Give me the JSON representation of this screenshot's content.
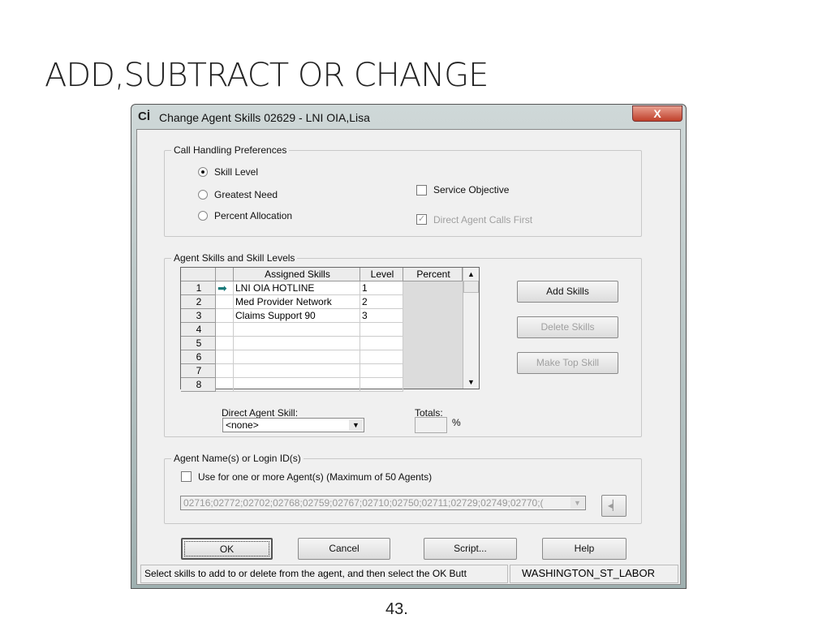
{
  "slide": {
    "title": "ADD,SUBTRACT OR CHANGE",
    "page_number": "43."
  },
  "dialog": {
    "title": "Change Agent Skills 02629 - LNI OIA,Lisa",
    "close_label": "X",
    "call_handling": {
      "label": "Call Handling Preferences",
      "options": [
        {
          "label": "Skill Level",
          "selected": true
        },
        {
          "label": "Greatest Need",
          "selected": false
        },
        {
          "label": "Percent Allocation",
          "selected": false
        }
      ],
      "service_objective": {
        "label": "Service Objective",
        "checked": false
      },
      "direct_agent_calls_first": {
        "label": "Direct Agent Calls First",
        "checked": true,
        "disabled": true
      }
    },
    "skills": {
      "label": "Agent Skills and Skill Levels",
      "columns": [
        "",
        "",
        "Assigned Skills",
        "Level",
        "Percent"
      ],
      "rows": [
        {
          "n": "1",
          "skill": "LNI OIA HOTLINE",
          "level": "1",
          "current": true
        },
        {
          "n": "2",
          "skill": "Med Provider Network",
          "level": "2"
        },
        {
          "n": "3",
          "skill": "Claims Support 90",
          "level": "3"
        },
        {
          "n": "4",
          "skill": "",
          "level": ""
        },
        {
          "n": "5",
          "skill": "",
          "level": ""
        },
        {
          "n": "6",
          "skill": "",
          "level": ""
        },
        {
          "n": "7",
          "skill": "",
          "level": ""
        },
        {
          "n": "8",
          "skill": "",
          "level": ""
        }
      ],
      "add_skills": "Add Skills",
      "delete_skills": "Delete Skills",
      "make_top_skill": "Make Top Skill",
      "direct_agent_skill_label": "Direct Agent Skill:",
      "direct_agent_skill_value": "<none>",
      "totals_label": "Totals:",
      "totals_value": "",
      "percent_sign": "%"
    },
    "agents": {
      "label": "Agent Name(s) or Login ID(s)",
      "use_multiple_label": "Use for one or more Agent(s)  (Maximum of 50  Agents)",
      "use_multiple_checked": false,
      "ids_value": "02716;02772;02702;02768;02759;02767;02710;02750;02711;02729;02749;02770;("
    },
    "buttons": {
      "ok": "OK",
      "cancel": "Cancel",
      "script": "Script...",
      "help": "Help"
    },
    "status": {
      "message": "Select skills to add to or delete from the agent, and then select the OK Butt",
      "site": "WASHINGTON_ST_LABOR"
    }
  }
}
